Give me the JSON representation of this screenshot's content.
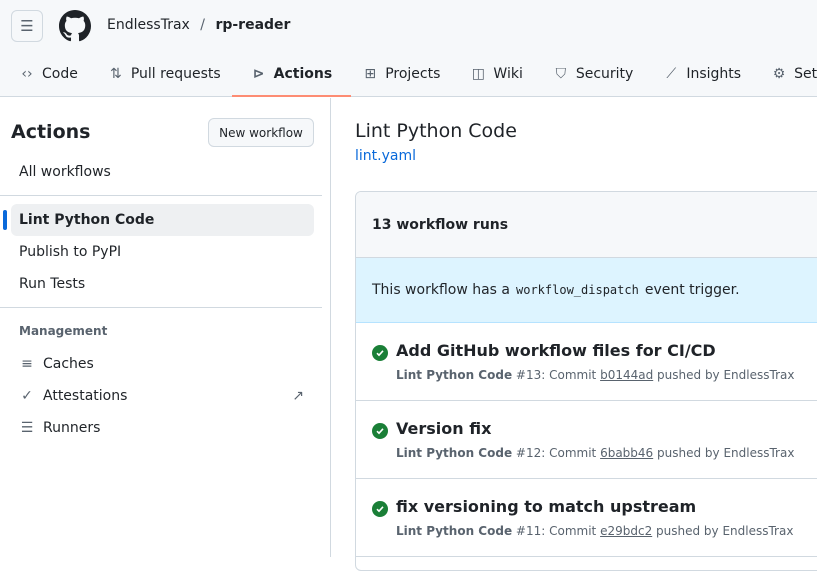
{
  "header": {
    "owner": "EndlessTrax",
    "separator": "/",
    "repo": "rp-reader"
  },
  "tabs": [
    {
      "label": "Code",
      "icon": "code-icon"
    },
    {
      "label": "Pull requests",
      "icon": "git-pull-request-icon"
    },
    {
      "label": "Actions",
      "icon": "play-icon",
      "active": true
    },
    {
      "label": "Projects",
      "icon": "table-icon"
    },
    {
      "label": "Wiki",
      "icon": "book-icon"
    },
    {
      "label": "Security",
      "icon": "shield-icon"
    },
    {
      "label": "Insights",
      "icon": "graph-icon"
    },
    {
      "label": "Settings",
      "icon": "gear-icon"
    }
  ],
  "sidebar": {
    "title": "Actions",
    "new_workflow": "New workflow",
    "all_workflows": "All workflows",
    "workflows": [
      "Lint Python Code",
      "Publish to PyPI",
      "Run Tests"
    ],
    "management_label": "Management",
    "management": [
      {
        "label": "Caches",
        "icon": "cache-icon"
      },
      {
        "label": "Attestations",
        "icon": "verified-icon"
      },
      {
        "label": "Runners",
        "icon": "server-icon"
      }
    ]
  },
  "main": {
    "title": "Lint Python Code",
    "file": "lint.yaml",
    "runs_count": "13 workflow runs",
    "banner_pre": "This workflow has a",
    "banner_code": "workflow_dispatch",
    "banner_post": "event trigger.",
    "runs": [
      {
        "title": "Add GitHub workflow files for CI/CD",
        "workflow": "Lint Python Code",
        "num": "#13",
        "commit_label": ": Commit",
        "sha": "b0144ad",
        "by": "pushed by EndlessTrax"
      },
      {
        "title": "Version fix",
        "workflow": "Lint Python Code",
        "num": "#12",
        "commit_label": ": Commit",
        "sha": "6babb46",
        "by": "pushed by EndlessTrax"
      },
      {
        "title": "fix versioning to match upstream",
        "workflow": "Lint Python Code",
        "num": "#11",
        "commit_label": ": Commit",
        "sha": "e29bdc2",
        "by": "pushed by EndlessTrax"
      }
    ]
  }
}
